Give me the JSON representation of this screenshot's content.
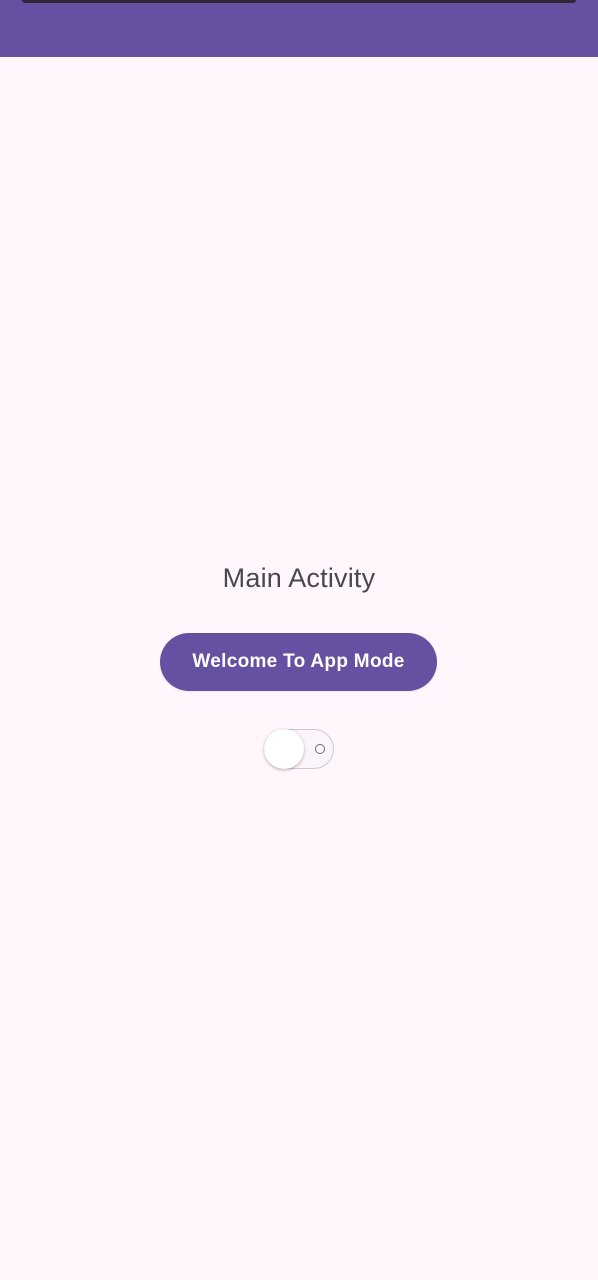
{
  "app_bar": {
    "color": "#6650a2"
  },
  "main": {
    "title": "Main Activity",
    "button_label": "Welcome To App Mode",
    "toggle": {
      "state": "off",
      "icon": "toggle-off-icon"
    }
  },
  "colors": {
    "background": "#fff7fc",
    "accent": "#6650a2",
    "title_text": "#4b4652"
  }
}
